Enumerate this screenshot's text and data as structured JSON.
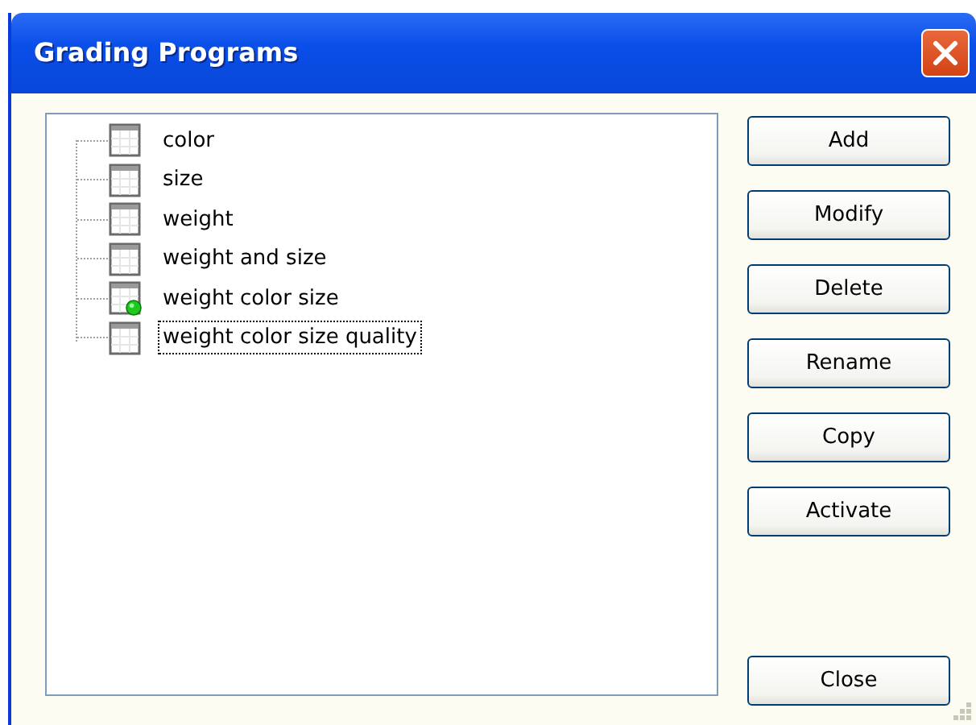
{
  "window": {
    "title": "Grading Programs"
  },
  "programs": [
    {
      "name": "color",
      "active": false,
      "selected": false
    },
    {
      "name": "size",
      "active": false,
      "selected": false
    },
    {
      "name": "weight",
      "active": false,
      "selected": false
    },
    {
      "name": "weight and size",
      "active": false,
      "selected": false
    },
    {
      "name": "weight color size",
      "active": true,
      "selected": false
    },
    {
      "name": "weight color size quality",
      "active": false,
      "selected": true
    }
  ],
  "buttons": [
    {
      "label": "Add"
    },
    {
      "label": "Modify"
    },
    {
      "label": "Delete"
    },
    {
      "label": "Rename"
    },
    {
      "label": "Copy"
    },
    {
      "label": "Activate"
    }
  ],
  "close_button": {
    "label": "Close"
  }
}
